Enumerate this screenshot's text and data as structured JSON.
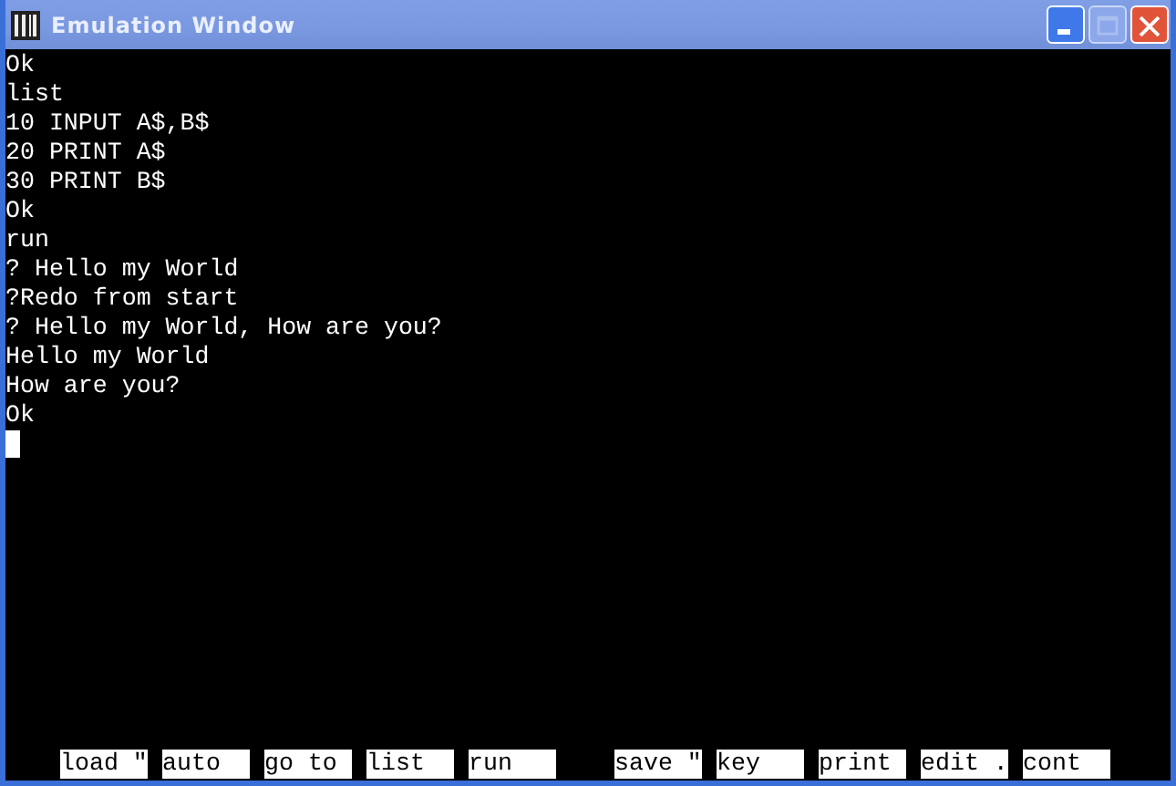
{
  "window": {
    "title": "Emulation Window"
  },
  "screen": {
    "lines": [
      "Ok",
      "list",
      "10 INPUT A$,B$",
      "20 PRINT A$",
      "30 PRINT B$",
      "Ok",
      "run",
      "? Hello my World",
      "?Redo from start",
      "? Hello my World, How are you?",
      "Hello my World",
      "How are you?",
      "Ok"
    ],
    "cursor": true
  },
  "function_keys": [
    [
      "load \"",
      "auto",
      "go to",
      "list",
      "run"
    ],
    [
      "save \"",
      "key",
      "print",
      "edit .",
      "cont"
    ]
  ]
}
